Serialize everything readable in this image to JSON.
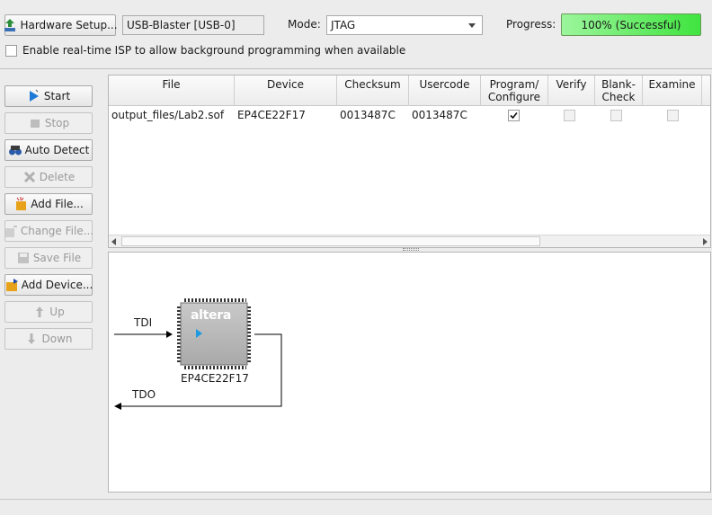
{
  "top": {
    "hardware_setup_label": "Hardware Setup...",
    "hardware_value": "USB-Blaster [USB-0]",
    "mode_label": "Mode:",
    "mode_value": "JTAG",
    "progress_label": "Progress:",
    "progress_value": "100% (Successful)",
    "progress_fraction": 1.0,
    "isp_label": "Enable real-time ISP to allow background programming when available",
    "isp_checked": false
  },
  "sidebar": {
    "buttons": [
      {
        "label": "Start",
        "icon": "start-icon",
        "enabled": true
      },
      {
        "label": "Stop",
        "icon": "stop-icon",
        "enabled": false
      },
      {
        "label": "Auto Detect",
        "icon": "auto-detect-icon",
        "enabled": true
      },
      {
        "label": "Delete",
        "icon": "delete-icon",
        "enabled": false
      },
      {
        "label": "Add File...",
        "icon": "add-file-icon",
        "enabled": true
      },
      {
        "label": "Change File...",
        "icon": "change-file-icon",
        "enabled": false
      },
      {
        "label": "Save File",
        "icon": "save-file-icon",
        "enabled": false
      },
      {
        "label": "Add Device...",
        "icon": "add-device-icon",
        "enabled": true
      },
      {
        "label": "Up",
        "icon": "up-icon",
        "enabled": false
      },
      {
        "label": "Down",
        "icon": "down-icon",
        "enabled": false
      }
    ]
  },
  "table": {
    "columns": [
      "File",
      "Device",
      "Checksum",
      "Usercode",
      "Program/\nConfigure",
      "Verify",
      "Blank-\nCheck",
      "Examine"
    ],
    "rows": [
      {
        "file": "output_files/Lab2.sof",
        "device": "EP4CE22F17",
        "checksum": "0013487C",
        "usercode": "0013487C",
        "program": true,
        "verify": false,
        "blank_check": false,
        "examine": false
      }
    ]
  },
  "diagram": {
    "chip_brand": "altera",
    "device_name": "EP4CE22F17",
    "tdi_label": "TDI",
    "tdo_label": "TDO"
  },
  "colors": {
    "progress_green": "#3fe43f",
    "start_blue": "#1e7ad6"
  }
}
